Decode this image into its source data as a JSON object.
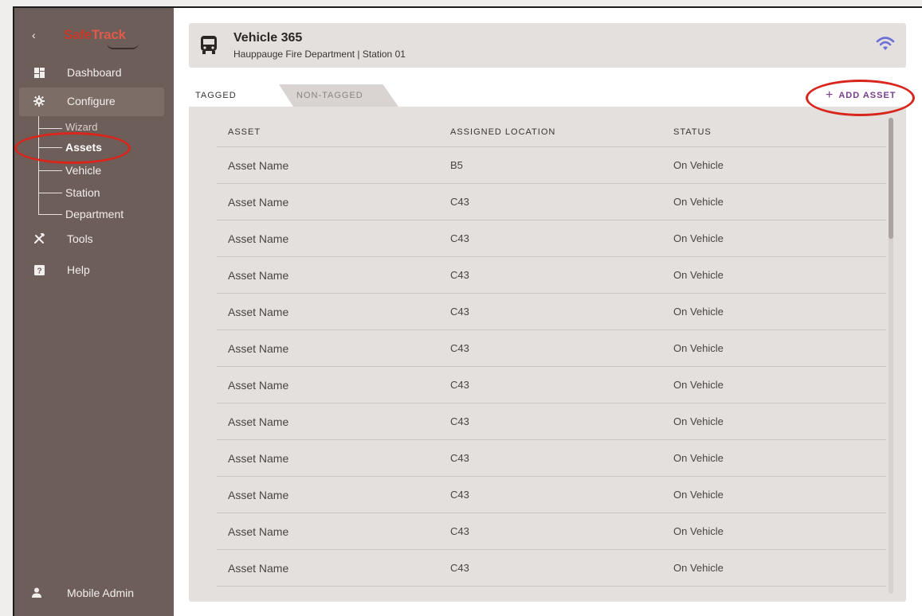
{
  "sidebar": {
    "logo": {
      "part1": "Safe",
      "part2": "Track"
    },
    "nav": [
      {
        "label": "Dashboard",
        "icon": "dashboard-icon"
      },
      {
        "label": "Configure",
        "icon": "gear-icon"
      },
      {
        "label": "Tools",
        "icon": "tools-icon"
      },
      {
        "label": "Help",
        "icon": "help-icon"
      }
    ],
    "sub": [
      {
        "label": "Wizard"
      },
      {
        "label": "Assets"
      },
      {
        "label": "Vehicle"
      },
      {
        "label": "Station"
      },
      {
        "label": "Department"
      }
    ],
    "user": {
      "label": "Mobile Admin",
      "icon": "user-icon"
    }
  },
  "header": {
    "title": "Vehicle 365",
    "subtitle": "Hauppauge Fire Department | Station 01"
  },
  "tabs": {
    "tagged": "TAGGED",
    "non_tagged": "NON-TAGGED"
  },
  "actions": {
    "add_asset": "ADD ASSET"
  },
  "table": {
    "headers": [
      "ASSET",
      "ASSIGNED LOCATION",
      "STATUS"
    ],
    "rows": [
      [
        "Asset Name",
        "B5",
        "On Vehicle"
      ],
      [
        "Asset Name",
        "C43",
        "On Vehicle"
      ],
      [
        "Asset Name",
        "C43",
        "On Vehicle"
      ],
      [
        "Asset Name",
        "C43",
        "On Vehicle"
      ],
      [
        "Asset Name",
        "C43",
        "On Vehicle"
      ],
      [
        "Asset Name",
        "C43",
        "On Vehicle"
      ],
      [
        "Asset Name",
        "C43",
        "On Vehicle"
      ],
      [
        "Asset Name",
        "C43",
        "On Vehicle"
      ],
      [
        "Asset Name",
        "C43",
        "On Vehicle"
      ],
      [
        "Asset Name",
        "C43",
        "On Vehicle"
      ],
      [
        "Asset Name",
        "C43",
        "On Vehicle"
      ],
      [
        "Asset Name",
        "C43",
        "On Vehicle"
      ]
    ]
  },
  "colors": {
    "sidebar": "#6e5e59",
    "accent": "#7a3c8e",
    "wifi": "#6b6fd6",
    "annotation": "#d8261c"
  }
}
